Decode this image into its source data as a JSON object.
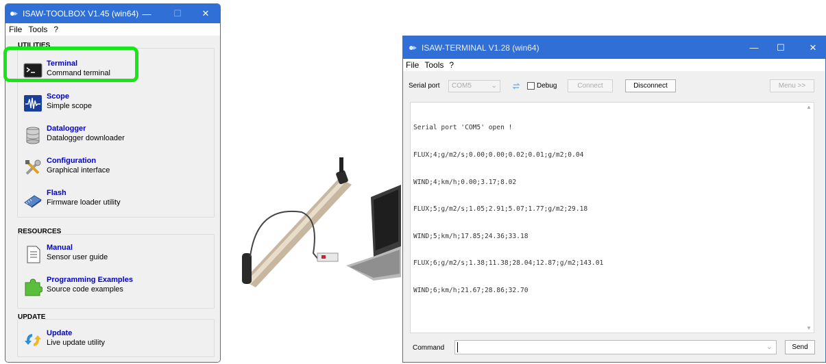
{
  "toolbox": {
    "title": "ISAW-TOOLBOX V1.45 (win64)",
    "menu": [
      "File",
      "Tools",
      "?"
    ],
    "sections": {
      "utilities": "UTILITIES",
      "resources": "RESOURCES",
      "update": "UPDATE"
    },
    "tools": {
      "terminal": {
        "name": "Terminal",
        "desc": "Command terminal"
      },
      "scope": {
        "name": "Scope",
        "desc": "Simple scope"
      },
      "datalogger": {
        "name": "Datalogger",
        "desc": "Datalogger downloader"
      },
      "configuration": {
        "name": "Configuration",
        "desc": "Graphical interface"
      },
      "flash": {
        "name": "Flash",
        "desc": "Firmware loader utility"
      },
      "manual": {
        "name": "Manual",
        "desc": "Sensor user guide"
      },
      "examples": {
        "name": "Programming Examples",
        "desc": "Source code examples"
      },
      "update": {
        "name": "Update",
        "desc": "Live update utility"
      }
    }
  },
  "terminal": {
    "title": "ISAW-TERMINAL V1.28 (win64)",
    "menu": [
      "File",
      "Tools",
      "?"
    ],
    "serial_port_label": "Serial port",
    "serial_port_value": "COM5",
    "debug_label": "Debug",
    "connect_label": "Connect",
    "disconnect_label": "Disconnect",
    "menu_button_label": "Menu >>",
    "output_lines": [
      "Serial port 'COM5' open !",
      "FLUX;4;g/m2/s;0.00;0.00;0.02;0.01;g/m2;0.04",
      "WIND;4;km/h;0.00;3.17;8.02",
      "FLUX;5;g/m2/s;1.05;2.91;5.07;1.77;g/m2;29.18",
      "WIND;5;km/h;17.85;24.36;33.18",
      "FLUX;6;g/m2/s;1.38;11.38;28.04;12.87;g/m2;143.01",
      "WIND;6;km/h;21.67;28.86;32.70"
    ],
    "command_label": "Command",
    "command_value": "",
    "send_label": "Send"
  },
  "colors": {
    "titlebar": "#2f6fd6",
    "highlight": "#19e619",
    "link": "#0000cc"
  }
}
